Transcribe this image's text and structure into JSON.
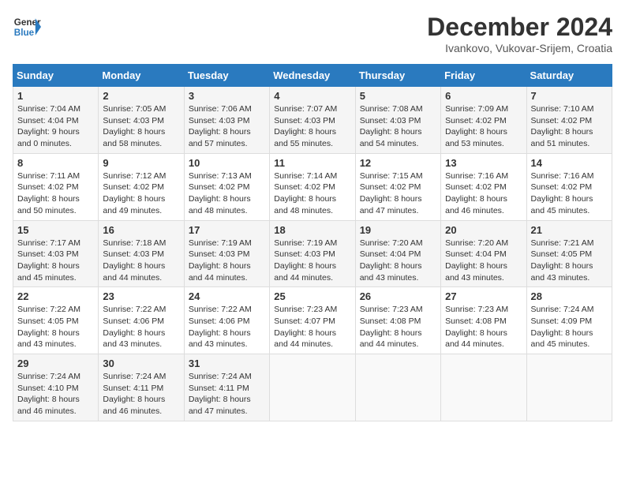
{
  "header": {
    "logo_line1": "General",
    "logo_line2": "Blue",
    "title": "December 2024",
    "subtitle": "Ivankovo, Vukovar-Srijem, Croatia"
  },
  "days_of_week": [
    "Sunday",
    "Monday",
    "Tuesday",
    "Wednesday",
    "Thursday",
    "Friday",
    "Saturday"
  ],
  "weeks": [
    [
      {
        "day": "1",
        "sunrise": "7:04 AM",
        "sunset": "4:04 PM",
        "daylight": "9 hours and 0 minutes."
      },
      {
        "day": "2",
        "sunrise": "7:05 AM",
        "sunset": "4:03 PM",
        "daylight": "8 hours and 58 minutes."
      },
      {
        "day": "3",
        "sunrise": "7:06 AM",
        "sunset": "4:03 PM",
        "daylight": "8 hours and 57 minutes."
      },
      {
        "day": "4",
        "sunrise": "7:07 AM",
        "sunset": "4:03 PM",
        "daylight": "8 hours and 55 minutes."
      },
      {
        "day": "5",
        "sunrise": "7:08 AM",
        "sunset": "4:03 PM",
        "daylight": "8 hours and 54 minutes."
      },
      {
        "day": "6",
        "sunrise": "7:09 AM",
        "sunset": "4:02 PM",
        "daylight": "8 hours and 53 minutes."
      },
      {
        "day": "7",
        "sunrise": "7:10 AM",
        "sunset": "4:02 PM",
        "daylight": "8 hours and 51 minutes."
      }
    ],
    [
      {
        "day": "8",
        "sunrise": "7:11 AM",
        "sunset": "4:02 PM",
        "daylight": "8 hours and 50 minutes."
      },
      {
        "day": "9",
        "sunrise": "7:12 AM",
        "sunset": "4:02 PM",
        "daylight": "8 hours and 49 minutes."
      },
      {
        "day": "10",
        "sunrise": "7:13 AM",
        "sunset": "4:02 PM",
        "daylight": "8 hours and 48 minutes."
      },
      {
        "day": "11",
        "sunrise": "7:14 AM",
        "sunset": "4:02 PM",
        "daylight": "8 hours and 48 minutes."
      },
      {
        "day": "12",
        "sunrise": "7:15 AM",
        "sunset": "4:02 PM",
        "daylight": "8 hours and 47 minutes."
      },
      {
        "day": "13",
        "sunrise": "7:16 AM",
        "sunset": "4:02 PM",
        "daylight": "8 hours and 46 minutes."
      },
      {
        "day": "14",
        "sunrise": "7:16 AM",
        "sunset": "4:02 PM",
        "daylight": "8 hours and 45 minutes."
      }
    ],
    [
      {
        "day": "15",
        "sunrise": "7:17 AM",
        "sunset": "4:03 PM",
        "daylight": "8 hours and 45 minutes."
      },
      {
        "day": "16",
        "sunrise": "7:18 AM",
        "sunset": "4:03 PM",
        "daylight": "8 hours and 44 minutes."
      },
      {
        "day": "17",
        "sunrise": "7:19 AM",
        "sunset": "4:03 PM",
        "daylight": "8 hours and 44 minutes."
      },
      {
        "day": "18",
        "sunrise": "7:19 AM",
        "sunset": "4:03 PM",
        "daylight": "8 hours and 44 minutes."
      },
      {
        "day": "19",
        "sunrise": "7:20 AM",
        "sunset": "4:04 PM",
        "daylight": "8 hours and 43 minutes."
      },
      {
        "day": "20",
        "sunrise": "7:20 AM",
        "sunset": "4:04 PM",
        "daylight": "8 hours and 43 minutes."
      },
      {
        "day": "21",
        "sunrise": "7:21 AM",
        "sunset": "4:05 PM",
        "daylight": "8 hours and 43 minutes."
      }
    ],
    [
      {
        "day": "22",
        "sunrise": "7:22 AM",
        "sunset": "4:05 PM",
        "daylight": "8 hours and 43 minutes."
      },
      {
        "day": "23",
        "sunrise": "7:22 AM",
        "sunset": "4:06 PM",
        "daylight": "8 hours and 43 minutes."
      },
      {
        "day": "24",
        "sunrise": "7:22 AM",
        "sunset": "4:06 PM",
        "daylight": "8 hours and 43 minutes."
      },
      {
        "day": "25",
        "sunrise": "7:23 AM",
        "sunset": "4:07 PM",
        "daylight": "8 hours and 44 minutes."
      },
      {
        "day": "26",
        "sunrise": "7:23 AM",
        "sunset": "4:08 PM",
        "daylight": "8 hours and 44 minutes."
      },
      {
        "day": "27",
        "sunrise": "7:23 AM",
        "sunset": "4:08 PM",
        "daylight": "8 hours and 44 minutes."
      },
      {
        "day": "28",
        "sunrise": "7:24 AM",
        "sunset": "4:09 PM",
        "daylight": "8 hours and 45 minutes."
      }
    ],
    [
      {
        "day": "29",
        "sunrise": "7:24 AM",
        "sunset": "4:10 PM",
        "daylight": "8 hours and 46 minutes."
      },
      {
        "day": "30",
        "sunrise": "7:24 AM",
        "sunset": "4:11 PM",
        "daylight": "8 hours and 46 minutes."
      },
      {
        "day": "31",
        "sunrise": "7:24 AM",
        "sunset": "4:11 PM",
        "daylight": "8 hours and 47 minutes."
      },
      null,
      null,
      null,
      null
    ]
  ]
}
